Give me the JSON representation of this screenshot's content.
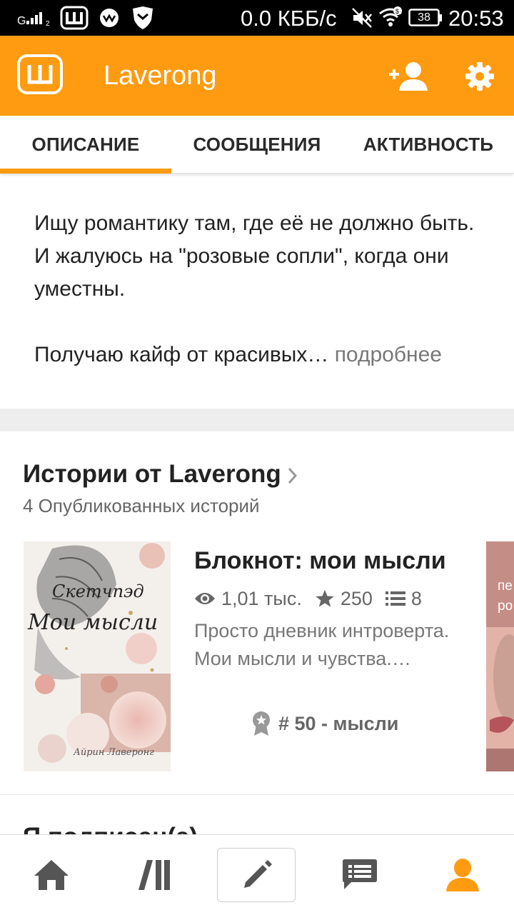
{
  "status_bar": {
    "network_speed": "0.0 КББ/с",
    "battery": "38",
    "time": "20:53"
  },
  "app_bar": {
    "title": "Laverong",
    "logo_letter": "Ш",
    "icons": [
      "app-logo",
      "add-user-icon",
      "gear-icon"
    ]
  },
  "tabs": [
    {
      "label": "ОПИСАНИЕ",
      "active": true
    },
    {
      "label": "СООБЩЕНИЯ",
      "active": false
    },
    {
      "label": "АКТИВНОСТЬ",
      "active": false
    }
  ],
  "description": {
    "paragraph1": "Ищу романтику там, где её не должно быть. И жалуюсь на \"розовые сопли\", когда они уместны.",
    "paragraph2": "Получаю кайф от красивых…",
    "more_label": "подробнее"
  },
  "stories_section": {
    "title": "Истории от Laverong",
    "subtitle": "4 Опубликованных историй"
  },
  "story": {
    "title": "Блокнот: мои мысли",
    "reads": "1,01 тыс.",
    "votes": "250",
    "parts": "8",
    "description": "Просто дневник интроверта. Мои мысли и чувства.…",
    "rank": "# 50 - мысли",
    "cover": {
      "line1": "Скетчпэд",
      "line2": "Мои мысли",
      "author": "Айрин Лаверонг"
    }
  },
  "next_story_cover": {
    "text1": "пе",
    "text2": "ро"
  },
  "following_section": {
    "title": "Я подписан(а)"
  },
  "bottom_nav": [
    "home-icon",
    "library-icon",
    "write-icon",
    "messages-icon",
    "profile-icon"
  ],
  "colors": {
    "accent": "#ff9b10",
    "text": "#222222",
    "muted": "#777777"
  }
}
